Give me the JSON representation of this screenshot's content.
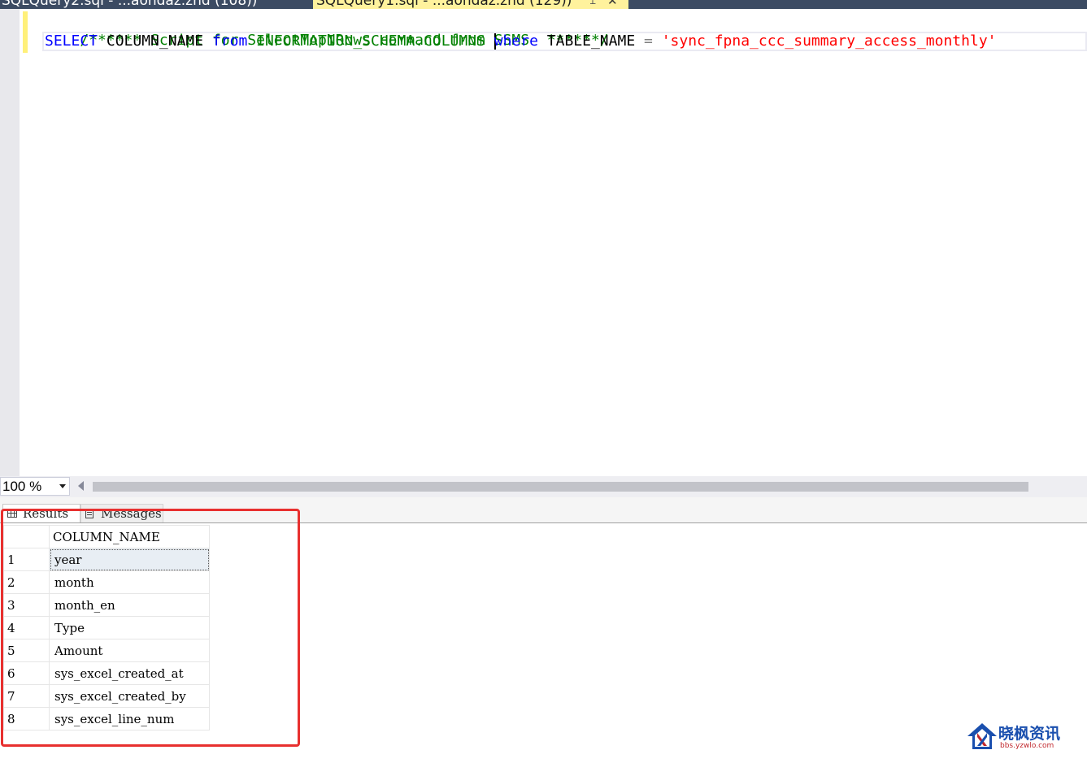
{
  "tabs": {
    "inactive": "SQLQuery2.sql - ...aohdaz.zhd (108))",
    "active": "SQLQuery1.sql - ...aohdaz.zhd (129))"
  },
  "editor": {
    "line1": {
      "comment": "/****** Script for SelectTopNRows command from SSMS  ******/"
    },
    "line2": {
      "kw_select": "SELECT",
      "col": "COLUMN_NAME",
      "kw_from": "from",
      "schema": "INFORMATION_SCHEMA.COLUMNS",
      "kw_where": "where",
      "tname": "TABLE_NAME",
      "op": "=",
      "str": "'sync_fpna_ccc_summary_access_monthly'"
    }
  },
  "zoom": {
    "value": "100 %"
  },
  "results_tabs": {
    "results": "Results",
    "messages": "Messages"
  },
  "grid": {
    "header": "COLUMN_NAME",
    "rows": [
      {
        "n": "1",
        "v": "year"
      },
      {
        "n": "2",
        "v": "month"
      },
      {
        "n": "3",
        "v": "month_en"
      },
      {
        "n": "4",
        "v": "Type"
      },
      {
        "n": "5",
        "v": "Amount"
      },
      {
        "n": "6",
        "v": "sys_excel_created_at"
      },
      {
        "n": "7",
        "v": "sys_excel_created_by"
      },
      {
        "n": "8",
        "v": "sys_excel_line_num"
      }
    ]
  },
  "watermark": {
    "title": "晓枫资讯",
    "url": "bbs.yzwlo.com"
  },
  "colors": {
    "keyword": "#0000ff",
    "comment": "#008000",
    "string": "#ff0000",
    "highlight_box": "#e8302f",
    "active_tab": "#fff29d"
  }
}
